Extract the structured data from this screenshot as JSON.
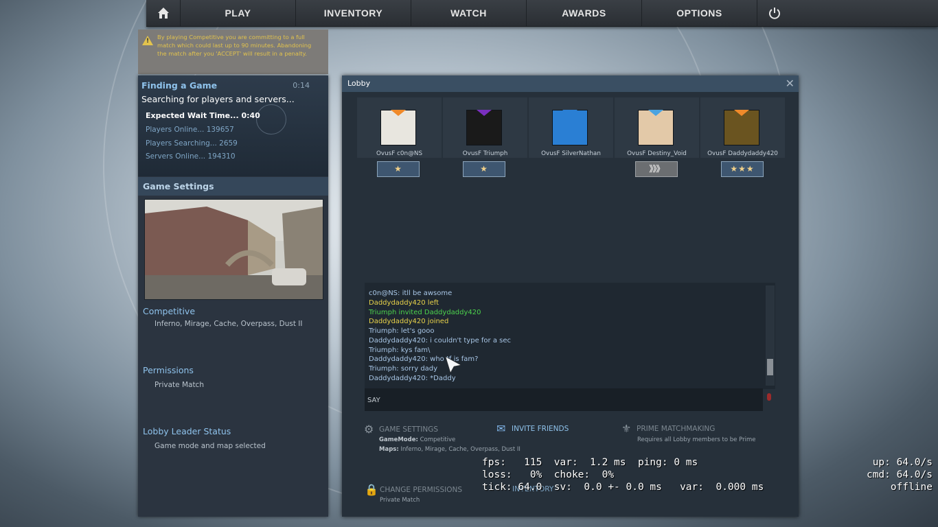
{
  "nav": {
    "home_icon": "home-icon",
    "items": [
      "PLAY",
      "INVENTORY",
      "WATCH",
      "AWARDS",
      "OPTIONS"
    ],
    "power_icon": "power-icon"
  },
  "warning": {
    "icon": "warning-icon",
    "text": "By playing Competitive you are committing to a full match which could last up to 90 minutes. Abandoning the match after you 'ACCEPT' will result in a penalty."
  },
  "finding": {
    "title": "Finding a Game",
    "timer": "0:14",
    "status": "Searching for players and servers...",
    "expected": "Expected Wait Time... 0:40",
    "players_online": "Players Online... 139657",
    "players_searching": "Players Searching... 2659",
    "servers_online": "Servers Online... 194310"
  },
  "game_settings": {
    "title": "Game Settings",
    "mode_label": "Competitive",
    "maps": "Inferno, Mirage, Cache, Overpass, Dust II",
    "permissions_label": "Permissions",
    "permissions_value": "Private Match",
    "leader_label": "Lobby Leader Status",
    "leader_value": "Game mode and map selected"
  },
  "lobby": {
    "title": "Lobby",
    "close_icon": "close-icon",
    "members": [
      {
        "name": "OvusF c0n@NS",
        "rank_icon": "rank-gold-nova-icon",
        "avatar_color": "#e8e6df",
        "tri_color": "#f08a2a"
      },
      {
        "name": "OvusF Triumph",
        "rank_icon": "rank-gold-nova-icon",
        "avatar_color": "#1a1a1a",
        "tri_color": "#7a2fbf"
      },
      {
        "name": "OvusF SilverNathan",
        "rank_icon": "",
        "avatar_color": "#2a7fd4",
        "tri_color": "#2a7fd4"
      },
      {
        "name": "OvusF Destiny_Void",
        "rank_icon": "rank-silver-elite-icon",
        "avatar_color": "#e3c9a8",
        "tri_color": "#4aa3e0"
      },
      {
        "name": "OvusF Daddydaddy420",
        "rank_icon": "rank-gold-nova-3-icon",
        "avatar_color": "#6a5420",
        "tri_color": "#f08a2a"
      }
    ],
    "rank_glyphs": [
      "★",
      "★",
      "",
      "》》》",
      "★★★"
    ],
    "chat": [
      {
        "text": "c0n@NS: itll be awsome",
        "color": "#a8c6e6"
      },
      {
        "text": "Daddydaddy420 left",
        "color": "#e8d24a"
      },
      {
        "text": "Triumph invited Daddydaddy420",
        "color": "#4cd24c"
      },
      {
        "text": "Daddydaddy420 joined",
        "color": "#e8d24a"
      },
      {
        "text": "Triumph: let's gooo",
        "color": "#a8c6e6"
      },
      {
        "text": "Daddydaddy420: i couldn't type for a sec",
        "color": "#a8c6e6"
      },
      {
        "text": "Triumph: kys fam\\",
        "color": "#a8c6e6"
      },
      {
        "text": "Daddydaddy420: who tf is fam?",
        "color": "#a8c6e6"
      },
      {
        "text": "Triumph: sorry dady",
        "color": "#a8c6e6"
      },
      {
        "text": "Daddydaddy420: *Daddy",
        "color": "#a8c6e6"
      }
    ],
    "say_label": "SAY",
    "mic_icon": "microphone-icon",
    "options": {
      "game_settings_title": "GAME SETTINGS",
      "game_mode_key": "GameMode:",
      "game_mode_val": "Competitive",
      "maps_key": "Maps:",
      "maps_val": "Inferno, Mirage, Cache, Overpass, Dust II",
      "invite_title": "INVITE FRIENDS",
      "prime_title": "PRIME MATCHMAKING",
      "prime_sub": "Requires all Lobby members to be Prime",
      "perm_title": "CHANGE PERMISSIONS",
      "perm_sub": "Private Match",
      "inventory_title": "INVENTORY"
    }
  },
  "netgraph": {
    "line1": "fps:   115  var:  1.2 ms  ping: 0 ms",
    "line2": "loss:   0%  choke:  0%",
    "line3": "tick: 64.0  sv:  0.0 +- 0.0 ms   var:  0.000 ms",
    "right1": "up: 64.0/s",
    "right2": "cmd: 64.0/s",
    "right3": "offline"
  }
}
